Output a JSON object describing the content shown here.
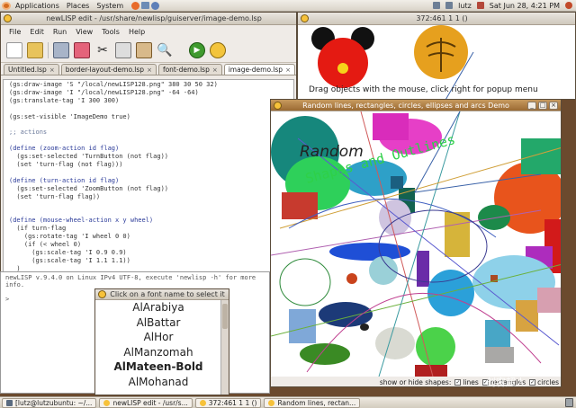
{
  "top_panel": {
    "menus": [
      "Applications",
      "Places",
      "System"
    ],
    "user": "lutz",
    "clock": "Sat Jun 28,  4:21 PM"
  },
  "editor": {
    "title": "newLISP edit - /usr/share/newlisp/guiserver/image-demo.lsp",
    "menu": [
      "File",
      "Edit",
      "Run",
      "View",
      "Tools",
      "Help"
    ],
    "tabs": [
      "Untitled.lsp",
      "border-layout-demo.lsp",
      "font-demo.lsp",
      "image-demo.lsp"
    ],
    "code_lines": [
      "(gs:draw-image 'S \"/local/newLISP128.png\" 380 30 50 32)",
      "(gs:draw-image 'I \"/local/newLISP128.png\" -64 -64)",
      "(gs:translate-tag 'I 300 300)",
      "",
      "(gs:set-visible 'ImageDemo true)",
      "",
      ";; actions",
      "",
      "(define (zoom-action id flag)",
      "  (gs:set-selected 'TurnButton (not flag))",
      "  (set 'turn-flag (not flag)))",
      "",
      "(define (turn-action id flag)",
      "  (gs:set-selected 'ZoomButton (not flag))",
      "  (set 'turn-flag flag))",
      "",
      "",
      "(define (mouse-wheel-action x y wheel)",
      "  (if turn-flag",
      "    (gs:rotate-tag 'I wheel 0 0)",
      "    (if (< wheel 0)",
      "      (gs:scale-tag 'I 0.9 0.9)",
      "      (gs:scale-tag 'I 1.1 1.1))",
      "  )"
    ],
    "console_line": "newLISP v.9.4.0 on Linux IPv4 UTF-8, execute 'newlisp -h' for more info.",
    "prompt": ">"
  },
  "font_popup": {
    "title": "Click on a font name to select it",
    "fonts": [
      "AlArabiya",
      "AlBattar",
      "AlHor",
      "AlManzomah",
      "AlMateen-Bold",
      "AlMohanad"
    ]
  },
  "image_demo": {
    "title": "372:461 1 1 ()",
    "caption": "Drag objects with the mouse, click right for popup menu"
  },
  "shapes_window": {
    "title": "Random lines, rectangles, circles, ellipses and arcs Demo",
    "text1": "Random",
    "text2": "Shapes and Outlines",
    "controls_label": "show or hide shapes:",
    "checkboxes": [
      "lines",
      "rectangles",
      "circles"
    ]
  },
  "taskbar": {
    "tasks": [
      "[lutz@lutzubuntu: ~/...",
      "newLISP edit - /usr/s...",
      "372:461 1 1 ()",
      "Random lines, rectan..."
    ]
  },
  "watermark": "创客超人"
}
